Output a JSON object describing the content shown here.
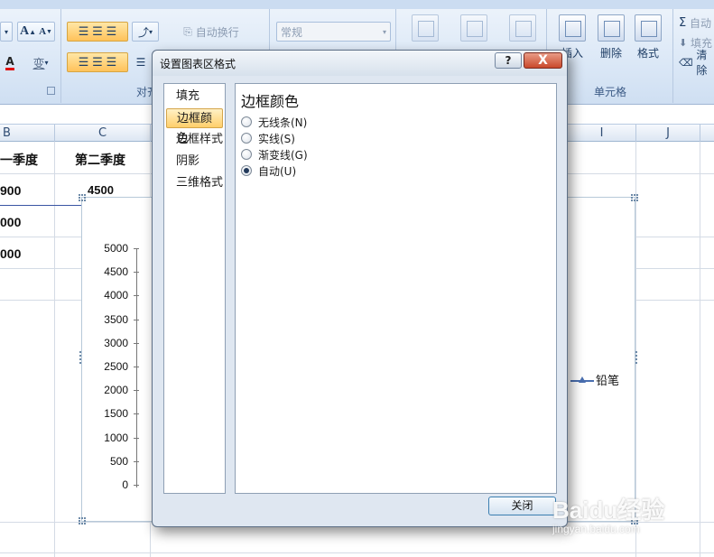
{
  "ribbon": {
    "wrap_text": "自动换行",
    "number_format": "常规",
    "align_group_label": "对齐",
    "cells_group_label": "单元格",
    "insert_label": "插入",
    "delete_label": "删除",
    "format_label": "格式",
    "autosum_label": "自动",
    "fill_label": "填充",
    "clear_label": "清除",
    "phonetic_glyph": "变",
    "font_grow": "A",
    "font_shrink": "A",
    "font_color_glyph": "A"
  },
  "sheet": {
    "columns": [
      "B",
      "C",
      "I",
      "J"
    ],
    "cells": {
      "b_header": "一季度",
      "c_header": "第二季度",
      "b_row1": "900",
      "b_row2": "000",
      "b_row3": "000",
      "c_row1": "4500"
    }
  },
  "chart_data": {
    "type": "line",
    "y_tick_labels": [
      "5000",
      "4500",
      "4000",
      "3500",
      "3000",
      "2500",
      "2000",
      "1500",
      "1000",
      "500",
      "0"
    ],
    "ylim": [
      0,
      5000
    ],
    "legend": {
      "position": "right",
      "entries": [
        "铅笔"
      ]
    }
  },
  "dialog": {
    "title": "设置图表区格式",
    "help_glyph": "?",
    "close_glyph": "X",
    "nav": [
      "填充",
      "边框颜色",
      "边框样式",
      "阴影",
      "三维格式"
    ],
    "selected_nav_index": 1,
    "panel_title": "边框颜色",
    "options": [
      "无线条(N)",
      "实线(S)",
      "渐变线(G)",
      "自动(U)"
    ],
    "selected_option_index": 3,
    "close_button": "关闭"
  },
  "watermark": {
    "main": "Baidu经验",
    "sub": "jingyan.baidu.com"
  }
}
